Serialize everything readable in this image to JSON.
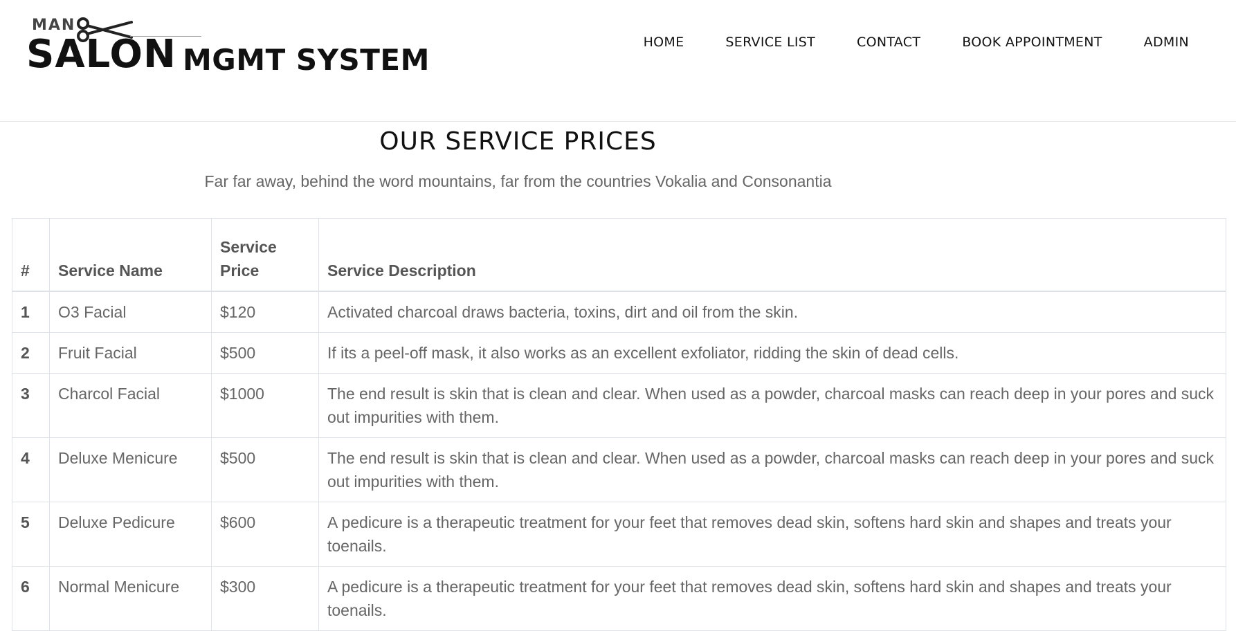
{
  "logo": {
    "top_text": "MAN",
    "main_text": "SALON",
    "suffix_text": "MGMT SYSTEM"
  },
  "nav": {
    "items": [
      {
        "label": "HOME"
      },
      {
        "label": "SERVICE LIST"
      },
      {
        "label": "CONTACT"
      },
      {
        "label": "BOOK APPOINTMENT"
      },
      {
        "label": "ADMIN"
      }
    ]
  },
  "page": {
    "title": "OUR SERVICE PRICES",
    "subtitle": "Far far away, behind the word mountains, far from the countries Vokalia and Consonantia"
  },
  "table": {
    "headers": [
      "#",
      "Service Name",
      "Service Price",
      "Service Description"
    ],
    "rows": [
      {
        "num": "1",
        "name": "O3 Facial",
        "price": "$120",
        "desc": "Activated charcoal draws bacteria, toxins, dirt and oil from the skin."
      },
      {
        "num": "2",
        "name": "Fruit Facial",
        "price": "$500",
        "desc": "If its a peel-off mask, it also works as an excellent exfoliator, ridding the skin of dead cells."
      },
      {
        "num": "3",
        "name": "Charcol Facial",
        "price": "$1000",
        "desc": "The end result is skin that is clean and clear. When used as a powder, charcoal masks can reach deep in your pores and suck out impurities with them."
      },
      {
        "num": "4",
        "name": "Deluxe Menicure",
        "price": "$500",
        "desc": "The end result is skin that is clean and clear. When used as a powder, charcoal masks can reach deep in your pores and suck out impurities with them."
      },
      {
        "num": "5",
        "name": "Deluxe Pedicure",
        "price": "$600",
        "desc": "A pedicure is a therapeutic treatment for your feet that removes dead skin, softens hard skin and shapes and treats your toenails."
      },
      {
        "num": "6",
        "name": "Normal Menicure",
        "price": "$300",
        "desc": "A pedicure is a therapeutic treatment for your feet that removes dead skin, softens hard skin and shapes and treats your toenails."
      }
    ]
  }
}
